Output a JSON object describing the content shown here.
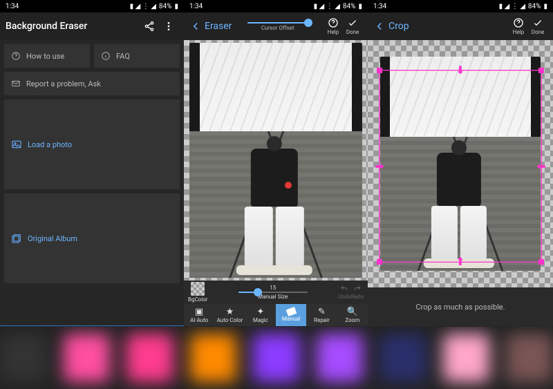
{
  "status": {
    "time": "1:34",
    "battery": "84%"
  },
  "panel1": {
    "title": "Background Eraser",
    "howto": "How to use",
    "faq": "FAQ",
    "report": "Report a problem, Ask",
    "load": "Load a photo",
    "album": "Original Album"
  },
  "panel2": {
    "back": "Eraser",
    "cursor_label": "Cursor Offset",
    "help": "Help",
    "done": "Done",
    "bgcolor": "BgColor",
    "manual_size_label": "Manual Size",
    "manual_size_value": "15",
    "undo": "Undo",
    "redo": "Redo",
    "tools": {
      "ai": "AI·Auto",
      "auto": "Auto·Color",
      "magic": "Magic",
      "manual": "Manual",
      "repair": "Repair",
      "zoom": "Zoom"
    }
  },
  "panel3": {
    "back": "Crop",
    "help": "Help",
    "done": "Done",
    "msg": "Crop as much as possible."
  },
  "colors": {
    "accent": "#6db6ff",
    "magenta": "#ff33cc"
  }
}
